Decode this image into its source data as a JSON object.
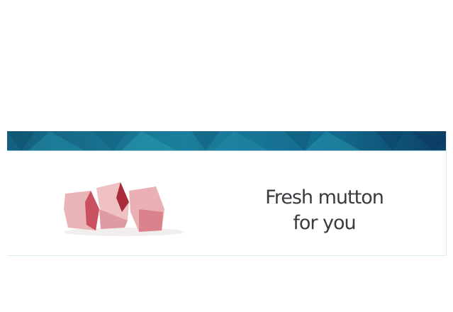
{
  "banner": {
    "tagline_line1": "Fresh mutton",
    "tagline_line2": "for you",
    "header_colors": [
      "#0f5c7d",
      "#1a8aa6",
      "#0b3e63"
    ],
    "text_color": "#3a3a40"
  }
}
